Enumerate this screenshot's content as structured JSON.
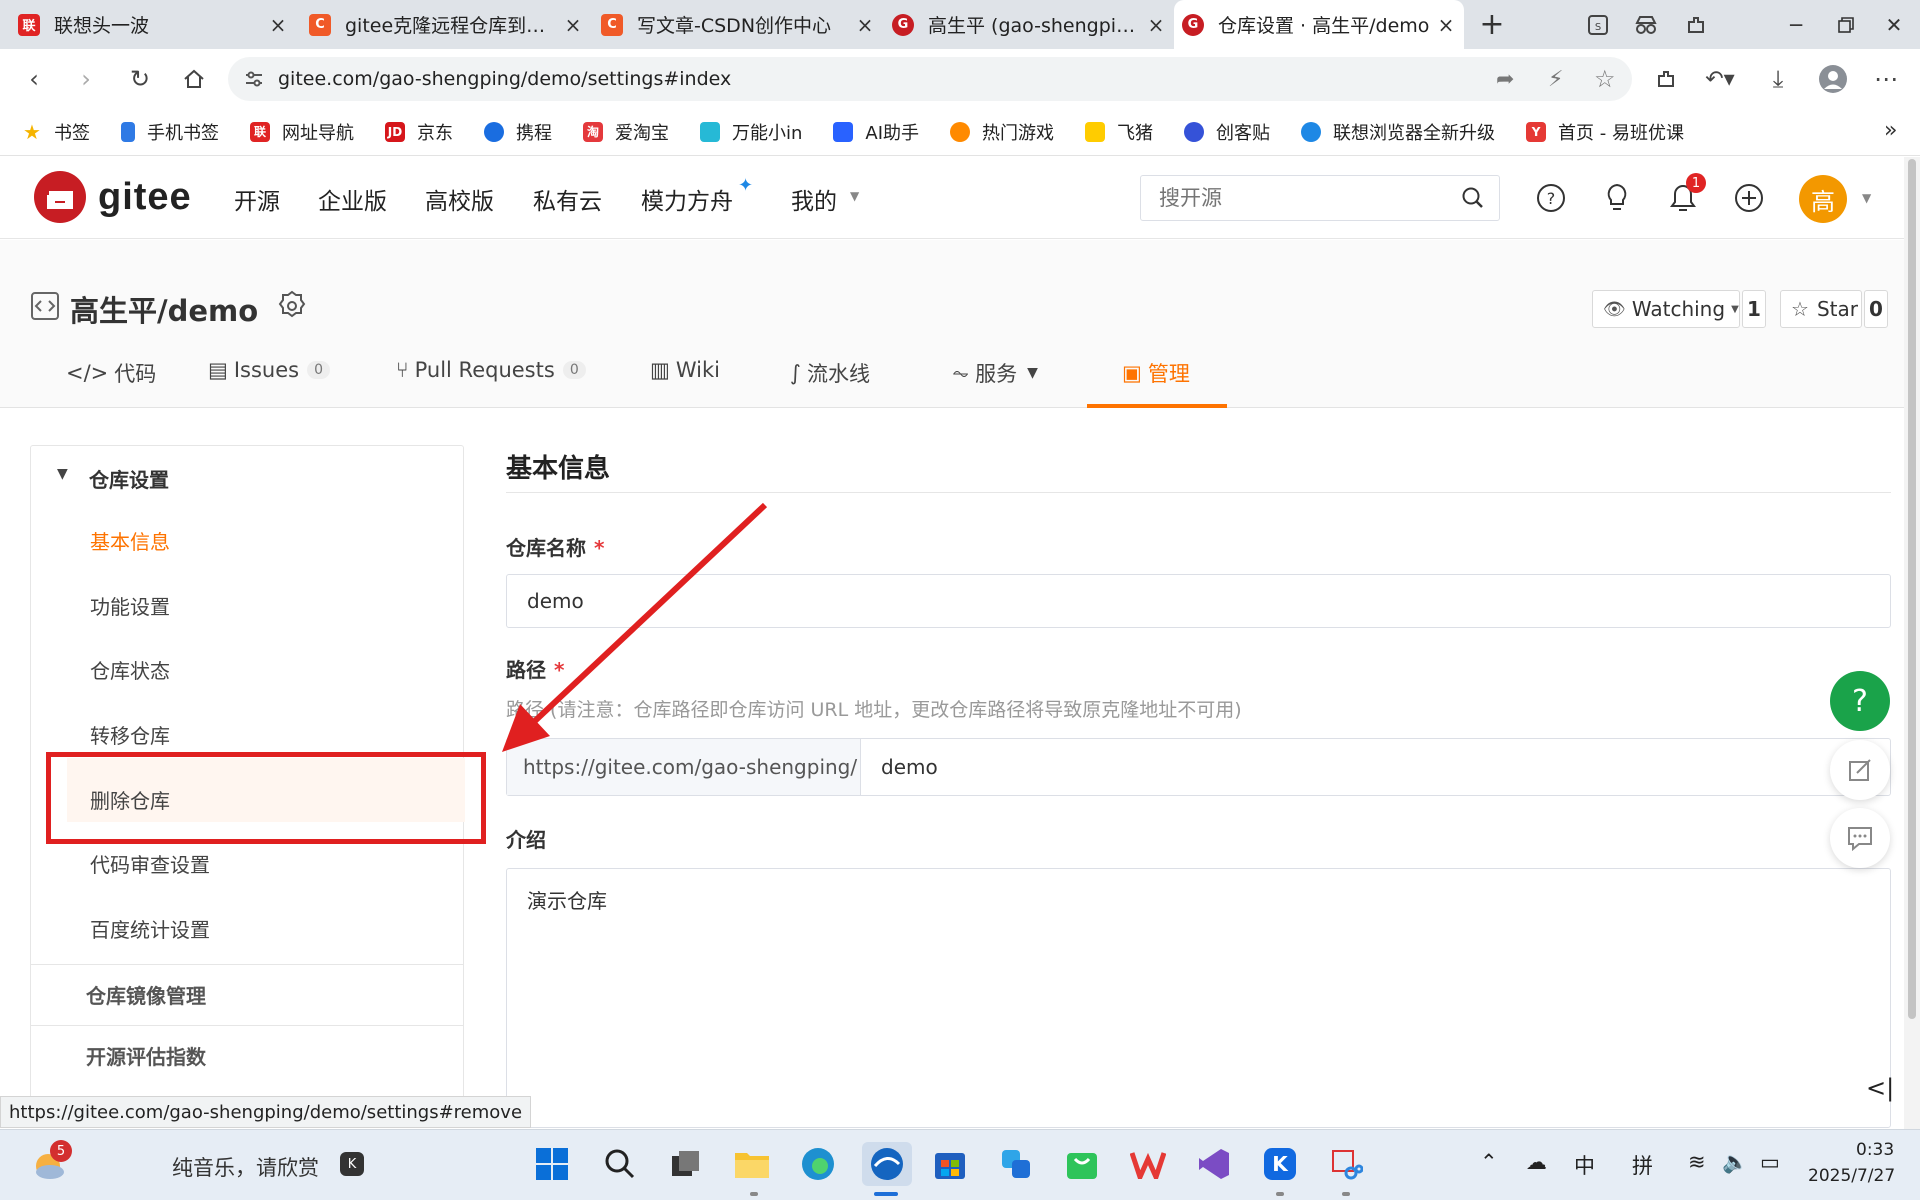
{
  "browser": {
    "tabs": [
      {
        "title": "联想头一波",
        "fav_color": "#e02424",
        "fav_text": "联"
      },
      {
        "title": "gitee克隆远程仓库到本地",
        "fav_color": "#f05a28",
        "fav_text": "C"
      },
      {
        "title": "写文章-CSDN创作中心",
        "fav_color": "#f05a28",
        "fav_text": "C"
      },
      {
        "title": "高生平 (gao-shengping)",
        "fav_color": "#c71d23",
        "fav_text": "G"
      },
      {
        "title": "仓库设置 · 高生平/demo",
        "fav_color": "#c71d23",
        "fav_text": "G"
      }
    ],
    "new_tab_label": "+",
    "url": "gitee.com/gao-shengping/demo/settings#index",
    "bookmarks": [
      {
        "label": "书签",
        "icon": "star-icon",
        "color": "#f5b400"
      },
      {
        "label": "手机书签",
        "icon": "phone-icon",
        "color": "#2f7ae5"
      },
      {
        "label": "网址导航",
        "icon": "nav-icon",
        "color": "#e02424"
      },
      {
        "label": "京东",
        "icon": "jd-icon",
        "color": "#d6161b"
      },
      {
        "label": "携程",
        "icon": "ctrip-icon",
        "color": "#1a6de0"
      },
      {
        "label": "爱淘宝",
        "icon": "taobao-icon",
        "color": "#e4393c"
      },
      {
        "label": "万能小in",
        "icon": "in-icon",
        "color": "#26b9d6"
      },
      {
        "label": "AI助手",
        "icon": "ai-icon",
        "color": "#2962ff"
      },
      {
        "label": "热门游戏",
        "icon": "game-icon",
        "color": "#ff8a00"
      },
      {
        "label": "飞猪",
        "icon": "fliggy-icon",
        "color": "#ffcc00"
      },
      {
        "label": "创客贴",
        "icon": "chuangke-icon",
        "color": "#3552d8"
      },
      {
        "label": "联想浏览器全新升级",
        "icon": "lenovo-browser-icon",
        "color": "#1e88e5"
      },
      {
        "label": "首页 - 易班优课",
        "icon": "yiban-icon",
        "color": "#e53935"
      }
    ],
    "bookmarks_overflow": "»",
    "status_url": "https://gitee.com/gao-shengping/demo/settings#remove"
  },
  "gitee": {
    "logo_text": "gitee",
    "nav": [
      "开源",
      "企业版",
      "高校版",
      "私有云",
      "模力方舟",
      "我的"
    ],
    "search_placeholder": "搜开源",
    "notification_count": "1",
    "avatar_text": "高",
    "accent": "#fe7300"
  },
  "repo": {
    "name": "高生平/demo",
    "watching_label": "Watching",
    "watching_count": "1",
    "star_label": "Star",
    "star_count": "0",
    "tabs": [
      {
        "label": "代码"
      },
      {
        "label": "Issues",
        "count": "0"
      },
      {
        "label": "Pull Requests",
        "count": "0"
      },
      {
        "label": "Wiki"
      },
      {
        "label": "流水线"
      },
      {
        "label": "服务"
      },
      {
        "label": "管理"
      }
    ]
  },
  "sidebar": {
    "section_title": "仓库设置",
    "items": [
      "基本信息",
      "功能设置",
      "仓库状态",
      "转移仓库",
      "删除仓库",
      "代码审查设置",
      "百度统计设置"
    ],
    "groups": [
      "仓库镜像管理",
      "开源评估指数"
    ]
  },
  "form": {
    "title": "基本信息",
    "name_label": "仓库名称",
    "name_value": "demo",
    "path_label": "路径",
    "path_hint": "路径 (请注意：仓库路径即仓库访问 URL 地址，更改仓库路径将导致原克隆地址不可用)",
    "path_prefix": "https://gitee.com/gao-shengping/",
    "path_value": "demo",
    "desc_label": "介绍",
    "desc_value": "演示仓库",
    "required_mark": "*"
  },
  "float_help": "?",
  "taskbar": {
    "weather_badge": "5",
    "music_text": "纯音乐，请欣赏",
    "ime_lang": "中",
    "ime_mode": "拼",
    "time": "0:33",
    "date": "2025/7/27"
  },
  "annotation": {
    "highlight_color": "#e02020"
  }
}
